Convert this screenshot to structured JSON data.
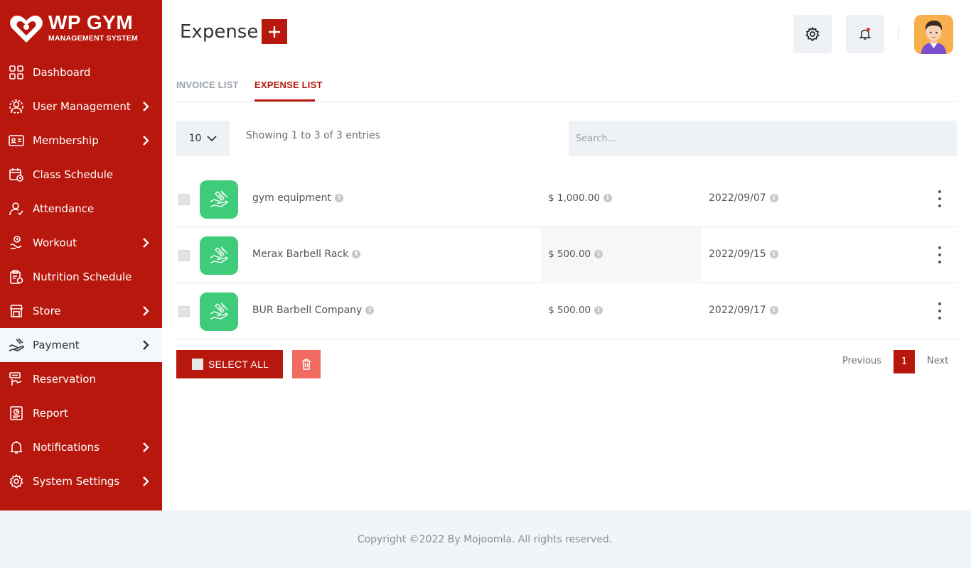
{
  "brand": {
    "title": "WP GYM",
    "subtitle": "MANAGEMENT SYSTEM"
  },
  "sidebar": {
    "items": [
      {
        "label": "Dashboard",
        "icon": "dashboard-icon",
        "has_submenu": false
      },
      {
        "label": "User Management",
        "icon": "user-management-icon",
        "has_submenu": true
      },
      {
        "label": "Membership",
        "icon": "membership-card-icon",
        "has_submenu": true
      },
      {
        "label": "Class Schedule",
        "icon": "calendar-icon",
        "has_submenu": false
      },
      {
        "label": "Attendance",
        "icon": "attendance-user-icon",
        "has_submenu": false
      },
      {
        "label": "Workout",
        "icon": "workout-icon",
        "has_submenu": true
      },
      {
        "label": "Nutrition Schedule",
        "icon": "clipboard-icon",
        "has_submenu": false
      },
      {
        "label": "Store",
        "icon": "store-icon",
        "has_submenu": true
      },
      {
        "label": "Payment",
        "icon": "payment-hand-icon",
        "has_submenu": true,
        "active": true
      },
      {
        "label": "Reservation",
        "icon": "reservation-icon",
        "has_submenu": false
      },
      {
        "label": "Report",
        "icon": "report-icon",
        "has_submenu": false
      },
      {
        "label": "Notifications",
        "icon": "bell-icon",
        "has_submenu": true
      },
      {
        "label": "System Settings",
        "icon": "gear-icon",
        "has_submenu": true
      }
    ]
  },
  "header": {
    "title": "Expense",
    "add_icon": "plus-icon",
    "settings_icon": "gear-icon",
    "notifications_icon": "bell-icon"
  },
  "tabs": [
    {
      "label": "INVOICE LIST",
      "active": false
    },
    {
      "label": "EXPENSE LIST",
      "active": true
    }
  ],
  "table": {
    "page_length": "10",
    "info": "Showing 1 to 3 of 3 entries",
    "search_placeholder": "Search...",
    "rows": [
      {
        "name": "gym equipment",
        "amount": "$ 1,000.00",
        "date": "2022/09/07"
      },
      {
        "name": "Merax Barbell Rack",
        "amount": "$ 500.00",
        "date": "2022/09/15"
      },
      {
        "name": "BUR Barbell Company",
        "amount": "$ 500.00",
        "date": "2022/09/17"
      }
    ]
  },
  "actions": {
    "select_all": "SELECT ALL"
  },
  "pagination": {
    "previous": "Previous",
    "current": "1",
    "next": "Next"
  },
  "footer": {
    "copyright": "Copyright ©2022 By Mojoomla. All rights reserved."
  },
  "colors": {
    "brand_red": "#b8170d",
    "thumb_green": "#3ecb7a",
    "delete_red": "#f26b61",
    "panel_gray": "#eef2f7"
  }
}
